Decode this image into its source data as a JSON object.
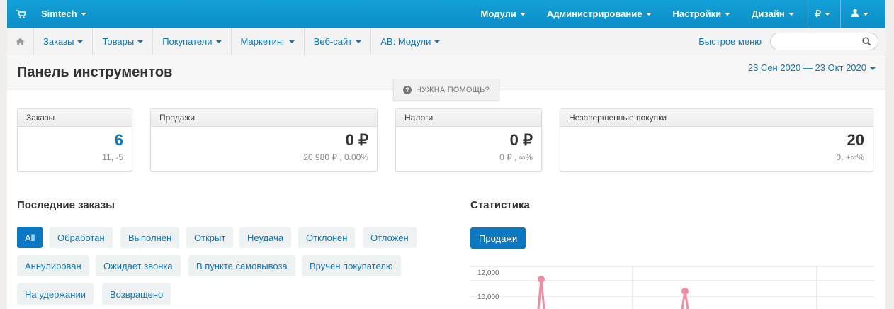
{
  "topbar": {
    "brand": "Simtech",
    "nav": [
      "Модули",
      "Администрирование",
      "Настройки",
      "Дизайн"
    ],
    "currency": "₽"
  },
  "subnav": {
    "items": [
      "Заказы",
      "Товары",
      "Покупатели",
      "Маркетинг",
      "Веб-сайт",
      "AB: Модули"
    ],
    "quick_menu": "Быстрое меню",
    "search_placeholder": ""
  },
  "page": {
    "title": "Панель инструментов",
    "date_range": "23 Сен 2020 — 23 Окт 2020",
    "help": "НУЖНА ПОМОЩЬ?"
  },
  "cards": [
    {
      "title": "Заказы",
      "value": "6",
      "sub": "11, -5"
    },
    {
      "title": "Продажи",
      "value": "0 ₽",
      "sub": "20 980 ₽ , 0.00%"
    },
    {
      "title": "Налоги",
      "value": "0 ₽",
      "sub": "0 ₽ , ∞%"
    },
    {
      "title": "Незавершенные покупки",
      "value": "20",
      "sub": "0, +∞%"
    }
  ],
  "recent_orders": {
    "title": "Последние заказы",
    "filters": [
      "All",
      "Обработан",
      "Выполнен",
      "Открыт",
      "Неудача",
      "Отклонен",
      "Отложен",
      "Аннулирован",
      "Ожидает звонка",
      "В пункте самовывоза",
      "Вручен покупателю",
      "На удержании",
      "Возвращено"
    ],
    "active": "All"
  },
  "statistics": {
    "title": "Статистика",
    "button": "Продажи"
  },
  "chart_data": {
    "type": "line",
    "yticks": [
      "12,000",
      "10,000"
    ],
    "series_color": "#f08ca8"
  },
  "colors": {
    "topbar": "#0c8ec7",
    "link": "#0a78c2",
    "chart_line": "#f08ca8"
  }
}
